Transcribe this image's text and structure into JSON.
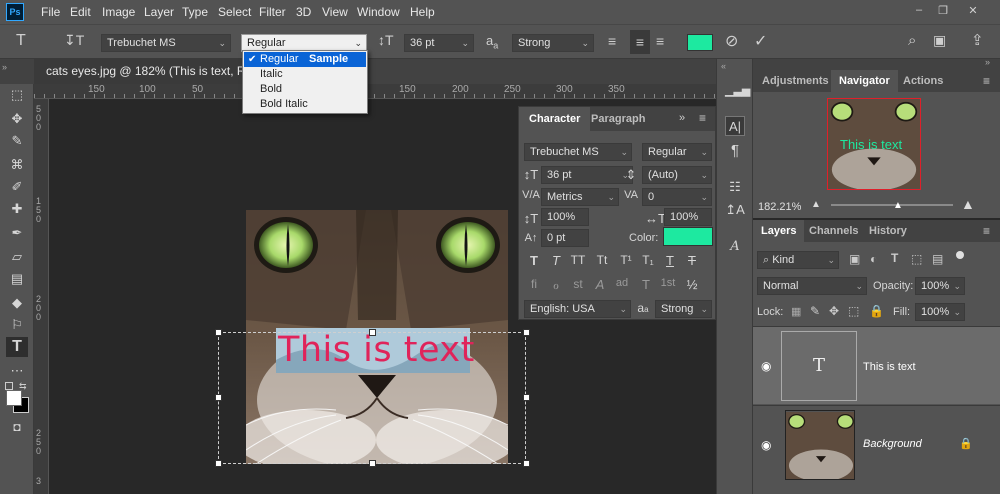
{
  "menubar": {
    "items": [
      "File",
      "Edit",
      "Image",
      "Layer",
      "Type",
      "Select",
      "Filter",
      "3D",
      "View",
      "Window",
      "Help"
    ],
    "logo": "Ps"
  },
  "options": {
    "font_family": "Trebuchet MS",
    "font_style": "Regular",
    "font_size": "36 pt",
    "antialias_icon": "a",
    "antialias_sub": "a",
    "antialias": "Strong",
    "text_color": "#1de9a0"
  },
  "style_dropdown": {
    "items": [
      "Regular",
      "Italic",
      "Bold",
      "Bold Italic"
    ],
    "selected": "Regular",
    "sample": "Sample"
  },
  "document": {
    "tab_title": "cats eyes.jpg @ 182% (This is text, RGB",
    "ruler_top": [
      "150",
      "100",
      "50",
      "0",
      "50",
      "100",
      "150",
      "200",
      "250",
      "300",
      "350"
    ],
    "ruler_left": [
      "5",
      "0",
      "0",
      "1",
      "5",
      "0",
      "2",
      "0",
      "0",
      "2",
      "5",
      "0",
      "3"
    ],
    "layer_text": "This is text"
  },
  "character_panel": {
    "tabs": [
      "Character",
      "Paragraph"
    ],
    "font_family": "Trebuchet MS",
    "font_style": "Regular",
    "size": "36 pt",
    "leading": "(Auto)",
    "kerning": "Metrics",
    "tracking": "0",
    "vertical_scale": "100%",
    "horizontal_scale": "100%",
    "baseline_shift": "0 pt",
    "color_label": "Color:",
    "color": "#1de9a0",
    "language": "English: USA",
    "aa_icon": "a",
    "aa_sub": "a",
    "antialias": "Strong",
    "glyphs_row1": [
      "T",
      "T",
      "TT",
      "Tt",
      "T¹",
      "T₁",
      "T",
      "T"
    ],
    "glyphs_row2": [
      "fi",
      "ℴ",
      "st",
      "A",
      "ad",
      "T",
      "1st",
      "½"
    ]
  },
  "nav_panel": {
    "tabs": [
      "Adjustments",
      "Navigator",
      "Actions"
    ],
    "active": "Navigator",
    "zoom": "182.21%",
    "thumb_text": "This is text"
  },
  "layers_panel": {
    "tabs": [
      "Layers",
      "Channels",
      "History"
    ],
    "active": "Layers",
    "filter": "Kind",
    "blend_mode": "Normal",
    "opacity_label": "Opacity:",
    "opacity": "100%",
    "lock_label": "Lock:",
    "fill_label": "Fill:",
    "fill": "100%",
    "layers": [
      {
        "name": "This is text",
        "type": "text",
        "thumb": "T"
      },
      {
        "name": "Background",
        "type": "image"
      }
    ]
  }
}
